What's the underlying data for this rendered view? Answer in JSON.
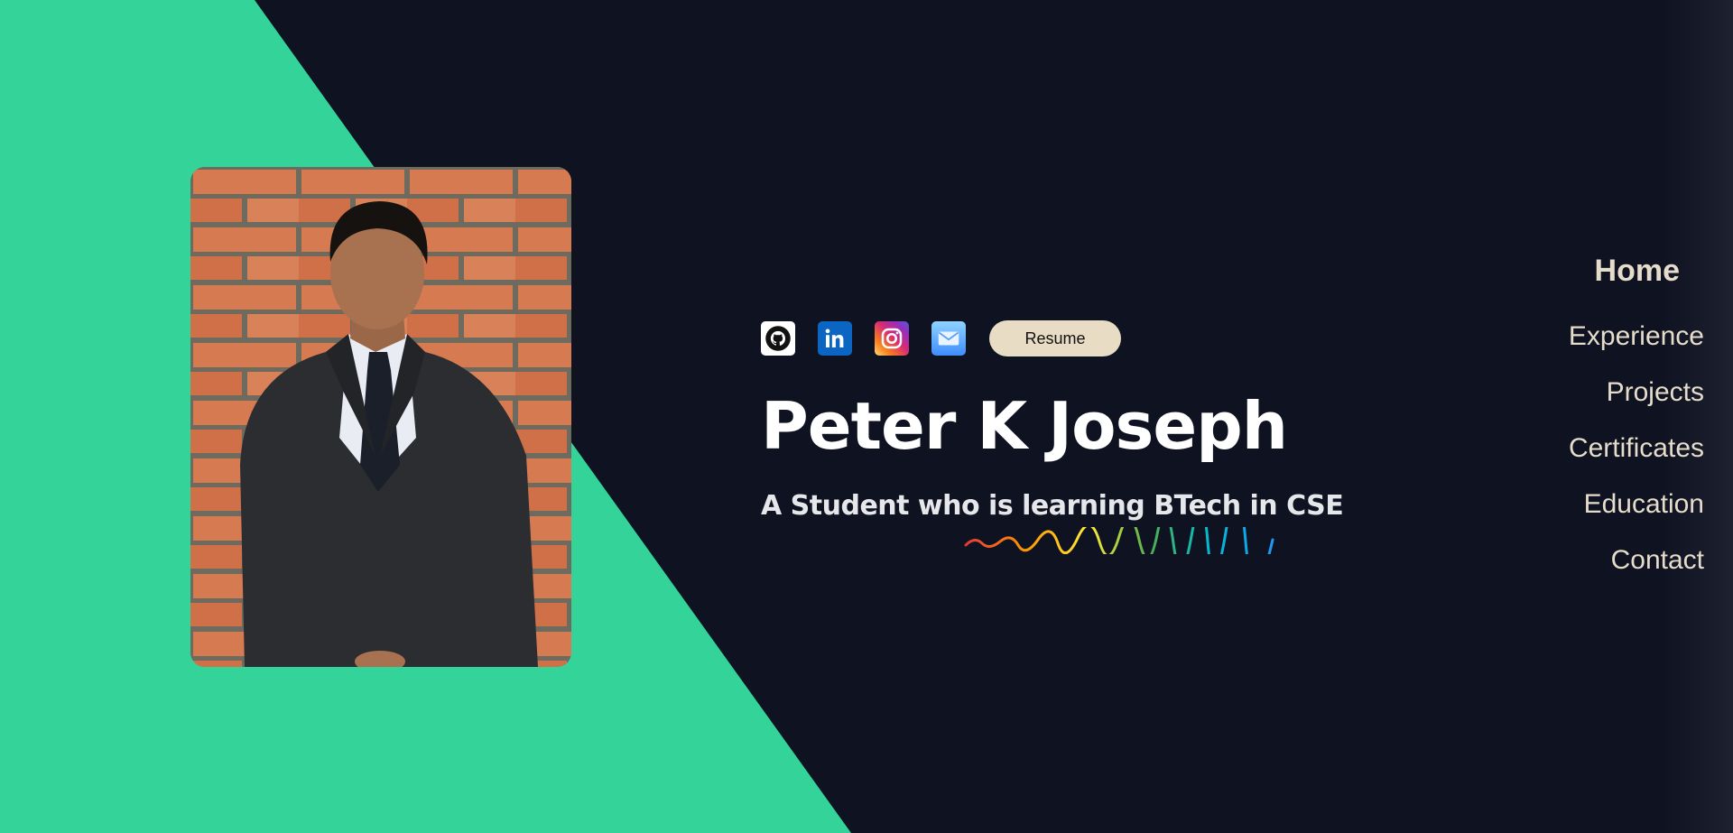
{
  "social": {
    "icons": [
      "github-icon",
      "linkedin-icon",
      "instagram-icon",
      "mail-icon"
    ],
    "resume_label": "Resume"
  },
  "hero": {
    "name": "Peter K Joseph",
    "tagline": "A Student who is learning BTech in CSE"
  },
  "nav": {
    "items": [
      "Home",
      "Experience",
      "Projects",
      "Certificates",
      "Education",
      "Contact"
    ]
  },
  "colors": {
    "background": "#0f1220",
    "accent_green": "#34d399",
    "nav_text": "#e6dccb",
    "resume_button": "#e8dcc4"
  }
}
